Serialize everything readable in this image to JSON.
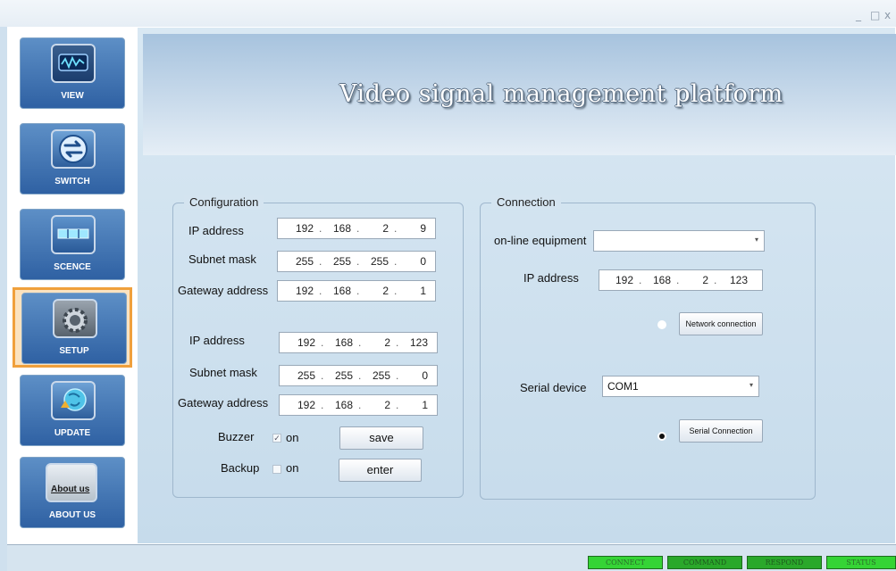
{
  "window": {
    "controls": {
      "minimize": "_",
      "maximize": "□",
      "close": "x"
    }
  },
  "app": {
    "title": "Video signal management platform"
  },
  "sidebar": {
    "items": [
      {
        "label": "VIEW",
        "icon": "waveform-monitor-icon",
        "selected": false
      },
      {
        "label": "SWITCH",
        "icon": "switch-arrows-icon",
        "selected": false
      },
      {
        "label": "SCENCE",
        "icon": "scene-grid-icon",
        "selected": false
      },
      {
        "label": "SETUP",
        "icon": "gear-icon",
        "selected": true
      },
      {
        "label": "UPDATE",
        "icon": "update-globe-icon",
        "selected": false
      },
      {
        "label": "ABOUT US",
        "icon": "about-us-icon",
        "icon_text": "About us",
        "selected": false
      }
    ]
  },
  "configuration": {
    "title": "Configuration",
    "block1": {
      "ip_label": "IP address",
      "ip": [
        "192",
        "168",
        "2",
        "9"
      ],
      "subnet_label": "Subnet mask",
      "subnet": [
        "255",
        "255",
        "255",
        "0"
      ],
      "gateway_label": "Gateway address",
      "gateway": [
        "192",
        "168",
        "2",
        "1"
      ]
    },
    "block2": {
      "ip_label": "IP address",
      "ip": [
        "192",
        "168",
        "2",
        "123"
      ],
      "subnet_label": "Subnet mask",
      "subnet": [
        "255",
        "255",
        "255",
        "0"
      ],
      "gateway_label": "Gateway address",
      "gateway": [
        "192",
        "168",
        "2",
        "1"
      ]
    },
    "buzzer": {
      "label": "Buzzer",
      "checkbox_label": "on",
      "checked": true,
      "check_mark": "✓"
    },
    "backup": {
      "label": "Backup",
      "checkbox_label": "on",
      "checked": false
    },
    "save_label": "save",
    "enter_label": "enter"
  },
  "connection": {
    "title": "Connection",
    "online_equipment_label": "on-line equipment",
    "online_equipment_value": "",
    "ip_label": "IP address",
    "ip": [
      "192",
      "168",
      "2",
      "123"
    ],
    "network_connection_label": "Network connection",
    "network_selected": false,
    "serial_device_label": "Serial device",
    "serial_device_value": "COM1",
    "serial_connection_label": "Serial Connection",
    "serial_selected": true
  },
  "status_bar": {
    "items": [
      {
        "label": "CONNECT",
        "color": "#35d435"
      },
      {
        "label": "COMMAND",
        "color": "#2aa82a"
      },
      {
        "label": "RESPOND",
        "color": "#2aa82a"
      },
      {
        "label": "STATUS",
        "color": "#35d435"
      }
    ]
  }
}
